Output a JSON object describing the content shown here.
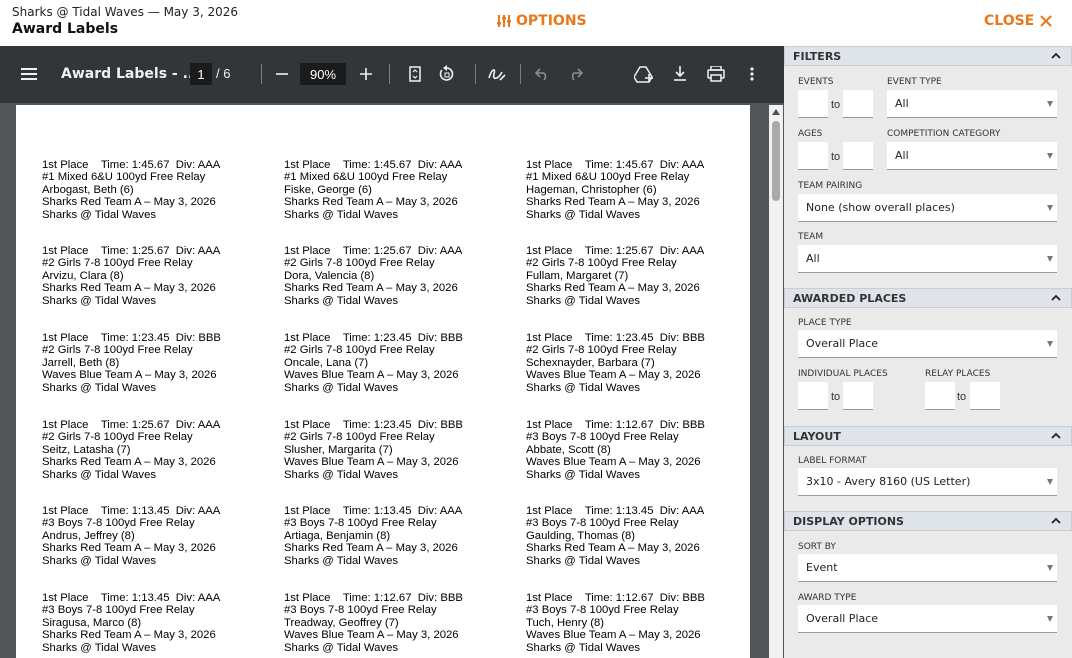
{
  "header": {
    "meet_line": "Sharks @ Tidal Waves — May 3, 2026",
    "title": "Award Labels",
    "options_label": "OPTIONS",
    "close_label": "CLOSE",
    "accent_color": "#e8781a"
  },
  "viewer": {
    "doc_title": "Award Labels - ...",
    "current_page": "1",
    "total_pages": "/ 6",
    "zoom": "90%",
    "icons": [
      "menu-icon",
      "minus-icon",
      "plus-icon",
      "fit-page-icon",
      "rotate-icon",
      "annotate-icon",
      "undo-icon",
      "redo-icon",
      "add-to-drive-icon",
      "download-icon",
      "print-icon",
      "more-vert-icon"
    ]
  },
  "labels": [
    [
      "1st Place    Time: 1:45.67  Div: AAA",
      "#1 Mixed 6&U 100yd Free Relay",
      "Arbogast, Beth (6)",
      "Sharks Red Team A – May 3, 2026",
      "Sharks @ Tidal Waves"
    ],
    [
      "1st Place    Time: 1:45.67  Div: AAA",
      "#1 Mixed 6&U 100yd Free Relay",
      "Fiske, George (6)",
      "Sharks Red Team A – May 3, 2026",
      "Sharks @ Tidal Waves"
    ],
    [
      "1st Place    Time: 1:45.67  Div: AAA",
      "#1 Mixed 6&U 100yd Free Relay",
      "Hageman, Christopher (6)",
      "Sharks Red Team A – May 3, 2026",
      "Sharks @ Tidal Waves"
    ],
    [
      "1st Place    Time: 1:25.67  Div: AAA",
      "#2 Girls 7-8 100yd Free Relay",
      "Arvizu, Clara (8)",
      "Sharks Red Team A – May 3, 2026",
      "Sharks @ Tidal Waves"
    ],
    [
      "1st Place    Time: 1:25.67  Div: AAA",
      "#2 Girls 7-8 100yd Free Relay",
      "Dora, Valencia (8)",
      "Sharks Red Team A – May 3, 2026",
      "Sharks @ Tidal Waves"
    ],
    [
      "1st Place    Time: 1:25.67  Div: AAA",
      "#2 Girls 7-8 100yd Free Relay",
      "Fullam, Margaret (7)",
      "Sharks Red Team A – May 3, 2026",
      "Sharks @ Tidal Waves"
    ],
    [
      "1st Place    Time: 1:23.45  Div: BBB",
      "#2 Girls 7-8 100yd Free Relay",
      "Jarrell, Beth (8)",
      "Waves Blue Team A – May 3, 2026",
      "Sharks @ Tidal Waves"
    ],
    [
      "1st Place    Time: 1:23.45  Div: BBB",
      "#2 Girls 7-8 100yd Free Relay",
      "Oncale, Lana (7)",
      "Waves Blue Team A – May 3, 2026",
      "Sharks @ Tidal Waves"
    ],
    [
      "1st Place    Time: 1:23.45  Div: BBB",
      "#2 Girls 7-8 100yd Free Relay",
      "Schexnayder, Barbara (7)",
      "Waves Blue Team A – May 3, 2026",
      "Sharks @ Tidal Waves"
    ],
    [
      "1st Place    Time: 1:25.67  Div: AAA",
      "#2 Girls 7-8 100yd Free Relay",
      "Seitz, Latasha (7)",
      "Sharks Red Team A – May 3, 2026",
      "Sharks @ Tidal Waves"
    ],
    [
      "1st Place    Time: 1:23.45  Div: BBB",
      "#2 Girls 7-8 100yd Free Relay",
      "Slusher, Margarita (7)",
      "Waves Blue Team A – May 3, 2026",
      "Sharks @ Tidal Waves"
    ],
    [
      "1st Place    Time: 1:12.67  Div: BBB",
      "#3 Boys 7-8 100yd Free Relay",
      "Abbate, Scott (8)",
      "Waves Blue Team A – May 3, 2026",
      "Sharks @ Tidal Waves"
    ],
    [
      "1st Place    Time: 1:13.45  Div: AAA",
      "#3 Boys 7-8 100yd Free Relay",
      "Andrus, Jeffrey (8)",
      "Sharks Red Team A – May 3, 2026",
      "Sharks @ Tidal Waves"
    ],
    [
      "1st Place    Time: 1:13.45  Div: AAA",
      "#3 Boys 7-8 100yd Free Relay",
      "Artiaga, Benjamin (8)",
      "Sharks Red Team A – May 3, 2026",
      "Sharks @ Tidal Waves"
    ],
    [
      "1st Place    Time: 1:13.45  Div: AAA",
      "#3 Boys 7-8 100yd Free Relay",
      "Gaulding, Thomas (8)",
      "Sharks Red Team A – May 3, 2026",
      "Sharks @ Tidal Waves"
    ],
    [
      "1st Place    Time: 1:13.45  Div: AAA",
      "#3 Boys 7-8 100yd Free Relay",
      "Siragusa, Marco (8)",
      "Sharks Red Team A – May 3, 2026",
      "Sharks @ Tidal Waves"
    ],
    [
      "1st Place    Time: 1:12.67  Div: BBB",
      "#3 Boys 7-8 100yd Free Relay",
      "Treadway, Geoffrey (7)",
      "Waves Blue Team A – May 3, 2026",
      "Sharks @ Tidal Waves"
    ],
    [
      "1st Place    Time: 1:12.67  Div: BBB",
      "#3 Boys 7-8 100yd Free Relay",
      "Tuch, Henry (8)",
      "Waves Blue Team A – May 3, 2026",
      "Sharks @ Tidal Waves"
    ]
  ],
  "panel": {
    "filters": {
      "heading": "FILTERS",
      "events_label": "EVENTS",
      "event_type_label": "EVENT TYPE",
      "event_type_value": "All",
      "ages_label": "AGES",
      "competition_category_label": "COMPETITION CATEGORY",
      "competition_category_value": "All",
      "team_pairing_label": "TEAM PAIRING",
      "team_pairing_value": "None (show overall places)",
      "team_label": "TEAM",
      "team_value": "All",
      "to_text": "to"
    },
    "awarded_places": {
      "heading": "AWARDED PLACES",
      "place_type_label": "PLACE TYPE",
      "place_type_value": "Overall Place",
      "individual_places_label": "INDIVIDUAL PLACES",
      "relay_places_label": "RELAY PLACES"
    },
    "layout": {
      "heading": "LAYOUT",
      "label_format_label": "LABEL FORMAT",
      "label_format_value": "3x10 - Avery 8160 (US Letter)"
    },
    "display_options": {
      "heading": "DISPLAY OPTIONS",
      "sort_by_label": "SORT BY",
      "sort_by_value": "Event",
      "award_type_label": "AWARD TYPE",
      "award_type_value": "Overall Place"
    }
  }
}
